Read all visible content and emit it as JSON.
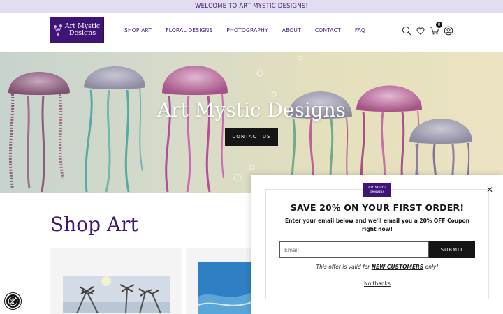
{
  "announcement": {
    "text": "WELCOME TO ART MYSTIC DESIGNS!"
  },
  "logo": {
    "line1": "Art Mystic",
    "line2": "Designs"
  },
  "nav": {
    "items": [
      {
        "label": "SHOP ART"
      },
      {
        "label": "FLORAL DESIGNS"
      },
      {
        "label": "PHOTOGRAPHY"
      },
      {
        "label": "ABOUT"
      },
      {
        "label": "CONTACT"
      },
      {
        "label": "FAQ"
      }
    ]
  },
  "header_icons": {
    "search": "search-icon",
    "wishlist": "heart-icon",
    "cart": "cart-icon",
    "cart_count": "0",
    "account": "user-icon"
  },
  "hero": {
    "title": "Art Mystic Designs",
    "button_label": "CONTACT US"
  },
  "section": {
    "title": "Shop Art"
  },
  "popup": {
    "logo_line1": "Art Mystic",
    "logo_line2": "Designs",
    "headline": "SAVE 20% ON YOUR FIRST ORDER!",
    "subtext": "Enter your email below and we'll email you a 20% OFF Coupon right now!",
    "email_placeholder": "Email",
    "submit_label": "SUBMIT",
    "note_prefix": "This offer is valid for ",
    "note_highlight": "NEW CUSTOMERS",
    "note_suffix": " only!",
    "dismiss_label": "No thanks"
  },
  "colors": {
    "brand": "#3e1575",
    "announcement_bg": "#e4dcf0",
    "button_dark": "#151515"
  }
}
